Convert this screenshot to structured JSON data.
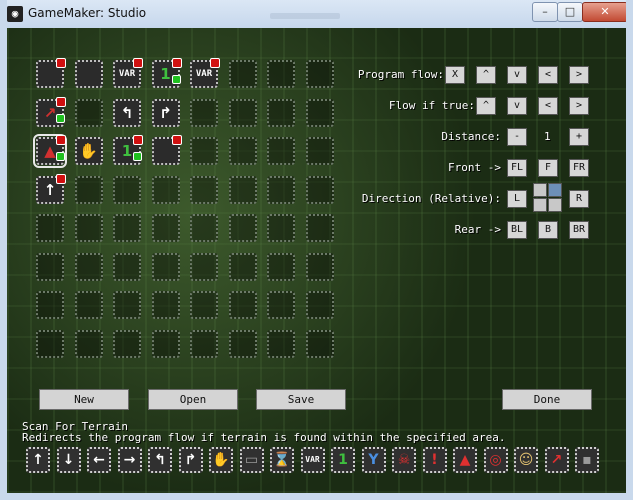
{
  "window": {
    "title": "GameMaker: Studio",
    "minimize_label": "–",
    "maximize_label": "□",
    "close_label": "✕"
  },
  "program_grid": {
    "columns": 8,
    "rows": 8,
    "cells": [
      {
        "col": 0,
        "row": 0,
        "glyph": "",
        "badge": true
      },
      {
        "col": 1,
        "row": 0,
        "glyph": "",
        "badge": false
      },
      {
        "col": 2,
        "row": 0,
        "glyph": "VAR",
        "style": "small",
        "badge": true
      },
      {
        "col": 3,
        "row": 0,
        "glyph": "1",
        "style": "green",
        "badge": true,
        "gbadge": true
      },
      {
        "col": 4,
        "row": 0,
        "glyph": "VAR",
        "style": "small",
        "badge": true
      },
      {
        "col": 0,
        "row": 1,
        "glyph": "↗",
        "style": "red",
        "badge": true,
        "gbadge": true
      },
      {
        "col": 2,
        "row": 1,
        "glyph": "↰",
        "badge": false
      },
      {
        "col": 3,
        "row": 1,
        "glyph": "↱",
        "badge": false
      },
      {
        "col": 0,
        "row": 2,
        "glyph": "▲",
        "style": "red",
        "badge": true,
        "gbadge": true,
        "selected": true
      },
      {
        "col": 1,
        "row": 2,
        "glyph": "✋",
        "style": "gray",
        "badge": false
      },
      {
        "col": 2,
        "row": 2,
        "glyph": "1",
        "style": "green",
        "badge": true,
        "gbadge": true
      },
      {
        "col": 3,
        "row": 2,
        "glyph": "",
        "badge": true
      },
      {
        "col": 0,
        "row": 3,
        "glyph": "↑",
        "badge": true
      }
    ]
  },
  "controls": {
    "program_flow": {
      "label": "Program flow:",
      "buttons": [
        "X",
        "^",
        "v",
        "<",
        ">"
      ]
    },
    "flow_if_true": {
      "label": "Flow if true:",
      "buttons": [
        "^",
        "v",
        "<",
        ">"
      ]
    },
    "distance": {
      "label": "Distance:",
      "minus": "-",
      "value": "1",
      "plus": "+"
    },
    "front": {
      "label": "Front ->",
      "buttons": [
        "FL",
        "F",
        "FR"
      ]
    },
    "direction": {
      "label": "Direction (Relative):",
      "left": "L",
      "right": "R"
    },
    "rear": {
      "label": "Rear ->",
      "buttons": [
        "BL",
        "B",
        "BR"
      ]
    }
  },
  "buttons": {
    "new": "New",
    "open": "Open",
    "save": "Save",
    "done": "Done"
  },
  "info": {
    "title": "Scan For Terrain",
    "description": "Redirects the program flow if terrain is found within the specified area."
  },
  "palette": [
    {
      "glyph": "↑"
    },
    {
      "glyph": "↓"
    },
    {
      "glyph": "←"
    },
    {
      "glyph": "→"
    },
    {
      "glyph": "↰"
    },
    {
      "glyph": "↱"
    },
    {
      "glyph": "✋",
      "style": "gray"
    },
    {
      "glyph": "▭",
      "style": "gray"
    },
    {
      "glyph": "⌛",
      "style": "amber"
    },
    {
      "glyph": "VAR",
      "style": "small"
    },
    {
      "glyph": "1",
      "style": "green"
    },
    {
      "glyph": "Y",
      "style": "blue"
    },
    {
      "glyph": "☠",
      "style": "red"
    },
    {
      "glyph": "!",
      "style": "red"
    },
    {
      "glyph": "▲",
      "style": "red"
    },
    {
      "glyph": "◎",
      "style": "red"
    },
    {
      "glyph": "☺",
      "style": "amber"
    },
    {
      "glyph": "↗",
      "style": "red"
    },
    {
      "glyph": "▪",
      "style": "gray"
    }
  ]
}
